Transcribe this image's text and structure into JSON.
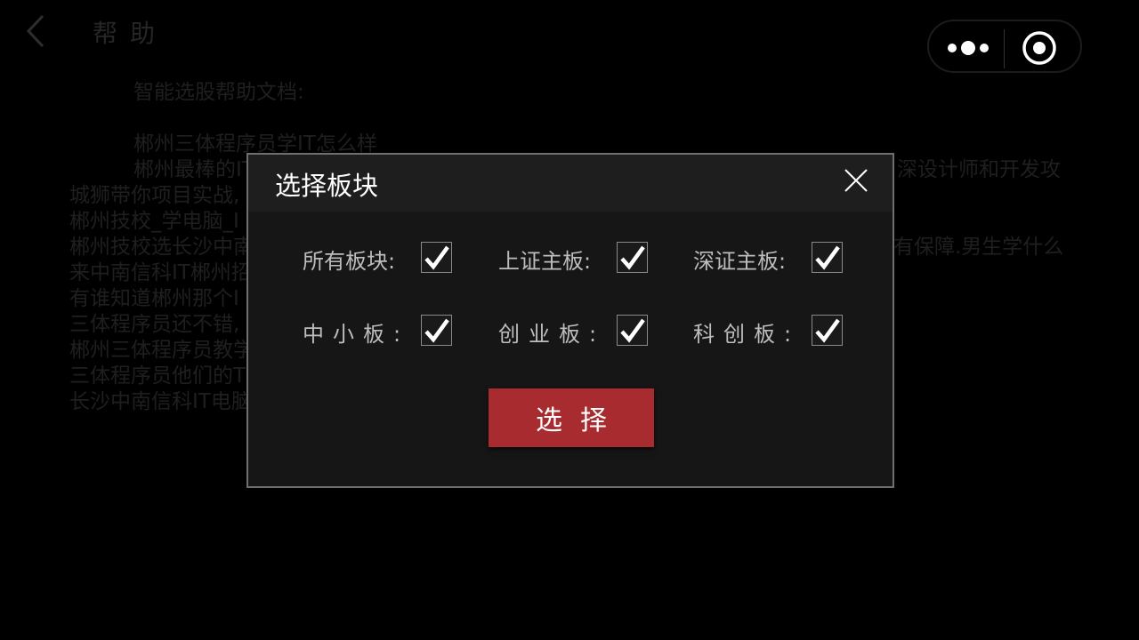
{
  "header": {
    "title": "帮助"
  },
  "doc": {
    "heading": "智能选股帮助文档:",
    "lines": [
      "郴州三体程序员学IT怎么样",
      "郴州最棒的IT",
      "深设计师和开发攻",
      "城狮带你项目实战,",
      "郴州技校_学电脑_I",
      "郴州技校选长沙中南",
      "有保障.男生学什么",
      "来中南信科IT郴州招",
      "有谁知道郴州那个I",
      "三体程序员还不错,",
      "郴州三体程序员教学",
      "三体程序员他们的T",
      "长沙中南信科IT电脑"
    ]
  },
  "dialog": {
    "title": "选择板块",
    "options": [
      {
        "label": "所有板块:",
        "checked": true
      },
      {
        "label": "上证主板:",
        "checked": true
      },
      {
        "label": "深证主板:",
        "checked": true
      },
      {
        "label": "中小板:",
        "checked": true
      },
      {
        "label": "创业板:",
        "checked": true
      },
      {
        "label": "科创板:",
        "checked": true
      }
    ],
    "select_label": "选择"
  },
  "colors": {
    "accent": "#a82b2f",
    "dialog_bg": "#161616",
    "dialog_header_bg": "#1e1e1e",
    "border": "#6f6f6f"
  },
  "icons": {
    "back": "chevron-left-icon",
    "more": "more-dots-icon",
    "capsule_target": "target-icon",
    "close": "close-icon",
    "check": "checkmark-icon"
  }
}
